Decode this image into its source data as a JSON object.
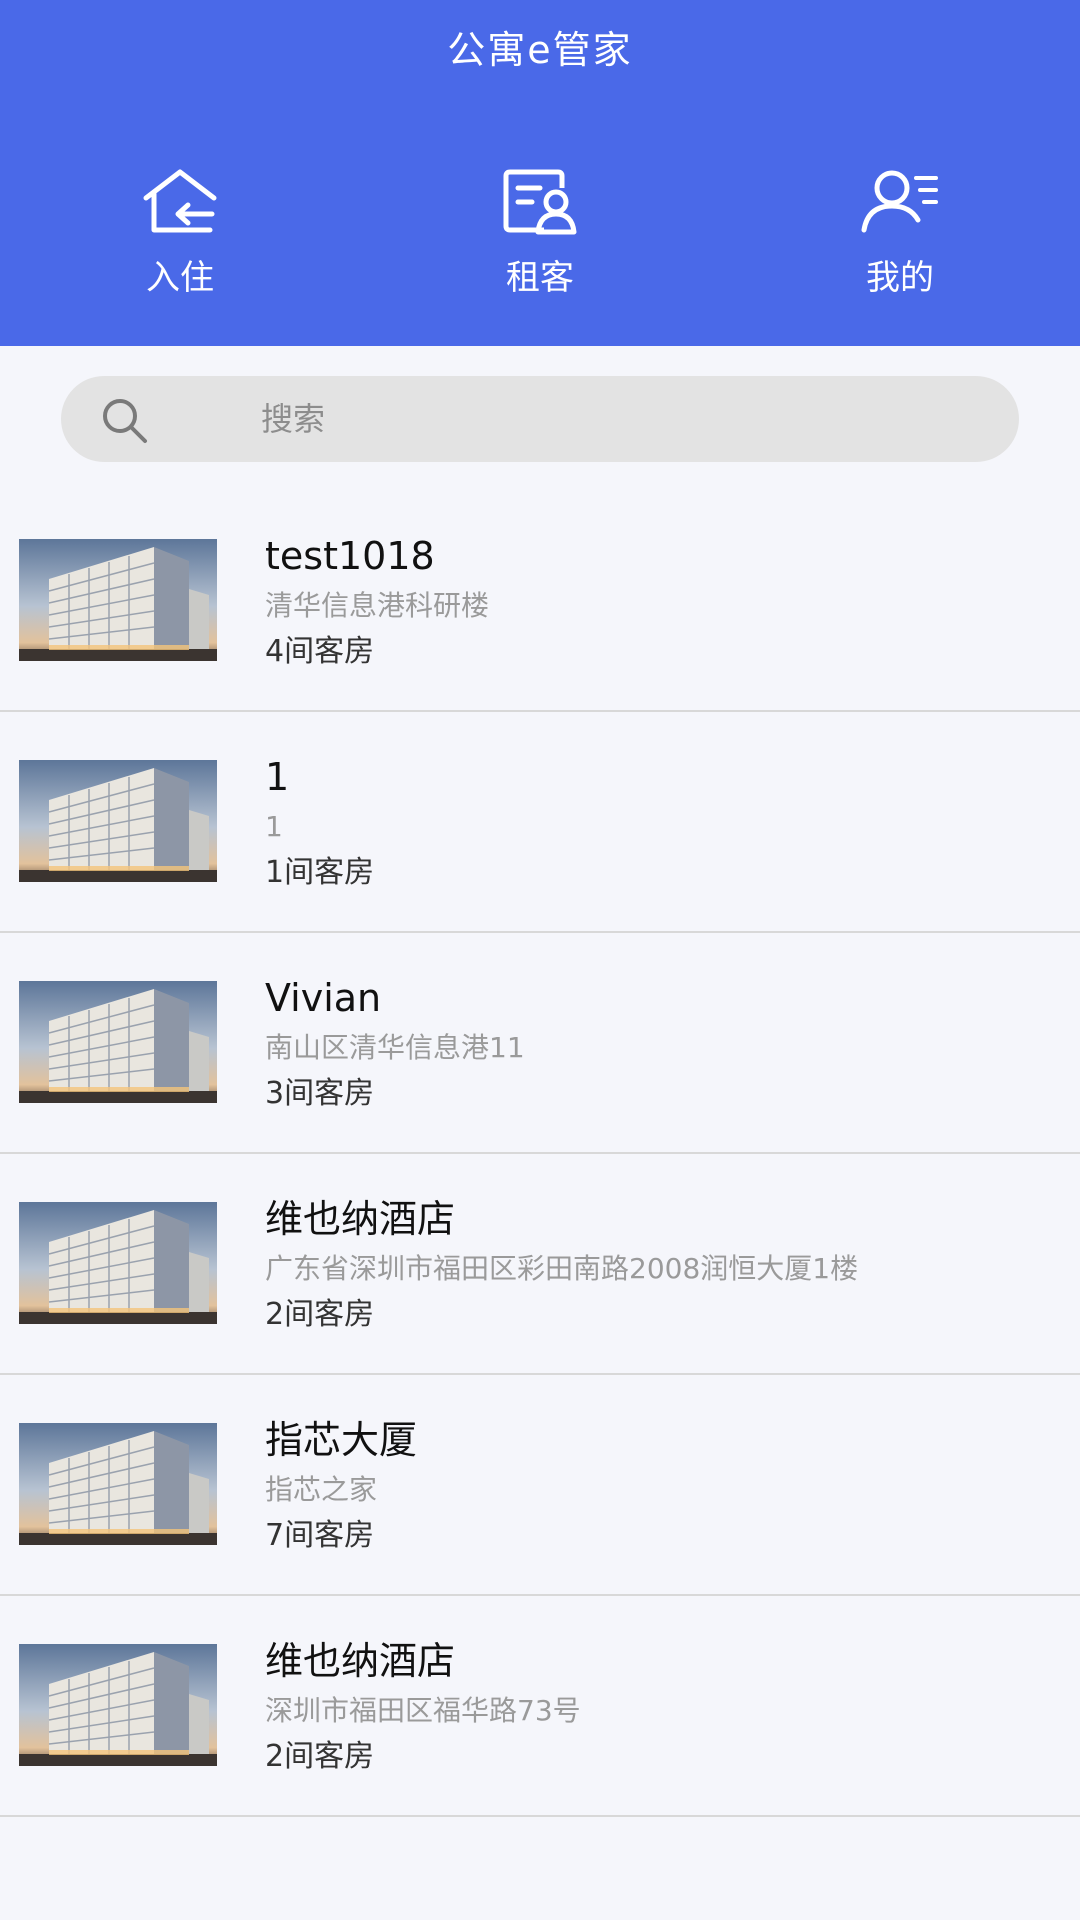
{
  "header": {
    "title": "公寓e管家",
    "background": "#4a69e8",
    "nav": [
      {
        "label": "入住",
        "icon": "house-checkin-icon"
      },
      {
        "label": "租客",
        "icon": "tenant-card-icon"
      },
      {
        "label": "我的",
        "icon": "user-profile-icon"
      }
    ]
  },
  "search": {
    "placeholder": "搜索",
    "value": "",
    "icon": "search-icon"
  },
  "apartments": [
    {
      "name": "test1018",
      "address": "清华信息港科研楼",
      "rooms": "4间客房"
    },
    {
      "name": "1",
      "address": "1",
      "rooms": "1间客房"
    },
    {
      "name": "Vivian",
      "address": "南山区清华信息港11",
      "rooms": "3间客房"
    },
    {
      "name": "维也纳酒店",
      "address": "广东省深圳市福田区彩田南路2008润恒大厦1楼",
      "rooms": "2间客房"
    },
    {
      "name": "指芯大厦",
      "address": "指芯之家",
      "rooms": "7间客房"
    },
    {
      "name": "维也纳酒店",
      "address": "深圳市福田区福华路73号",
      "rooms": "2间客房"
    }
  ]
}
